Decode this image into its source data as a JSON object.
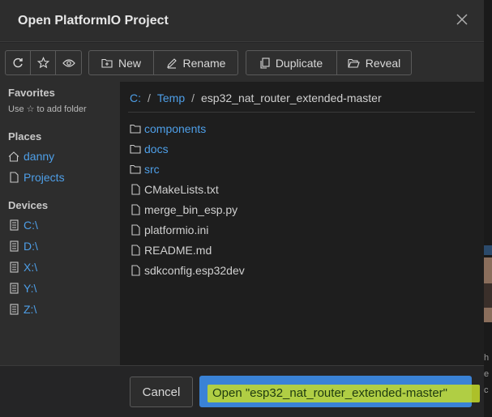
{
  "dialog": {
    "title": "Open PlatformIO Project",
    "close_icon": "close-icon"
  },
  "toolbar": {
    "refresh_icon": "refresh-icon",
    "star_icon": "star-icon",
    "eye_icon": "eye-icon",
    "new_label": "New",
    "rename_label": "Rename",
    "duplicate_label": "Duplicate",
    "reveal_label": "Reveal"
  },
  "sidebar": {
    "favorites_title": "Favorites",
    "favorites_hint": "Use ☆ to add folder",
    "places_title": "Places",
    "places": [
      {
        "label": "danny",
        "icon": "home-icon"
      },
      {
        "label": "Projects",
        "icon": "file-icon"
      }
    ],
    "devices_title": "Devices",
    "devices": [
      {
        "label": "C:\\",
        "icon": "drive-icon"
      },
      {
        "label": "D:\\",
        "icon": "drive-icon"
      },
      {
        "label": "X:\\",
        "icon": "drive-icon"
      },
      {
        "label": "Y:\\",
        "icon": "drive-icon"
      },
      {
        "label": "Z:\\",
        "icon": "drive-icon"
      }
    ]
  },
  "breadcrumb": {
    "parts": [
      "C:",
      "Temp",
      "esp32_nat_router_extended-master"
    ],
    "separator": "/"
  },
  "files": [
    {
      "name": "components",
      "type": "folder"
    },
    {
      "name": "docs",
      "type": "folder"
    },
    {
      "name": "src",
      "type": "folder"
    },
    {
      "name": "CMakeLists.txt",
      "type": "file"
    },
    {
      "name": "merge_bin_esp.py",
      "type": "file"
    },
    {
      "name": "platformio.ini",
      "type": "file"
    },
    {
      "name": "README.md",
      "type": "file"
    },
    {
      "name": "sdkconfig.esp32dev",
      "type": "file"
    }
  ],
  "footer": {
    "cancel_label": "Cancel",
    "open_label": "Open \"esp32_nat_router_extended-master\""
  },
  "background": {
    "right_text": [
      "h",
      "e",
      "c"
    ]
  },
  "colors": {
    "accent": "#3a82d6",
    "link": "#4e9fe8",
    "highlight": "#c6dc2a"
  }
}
